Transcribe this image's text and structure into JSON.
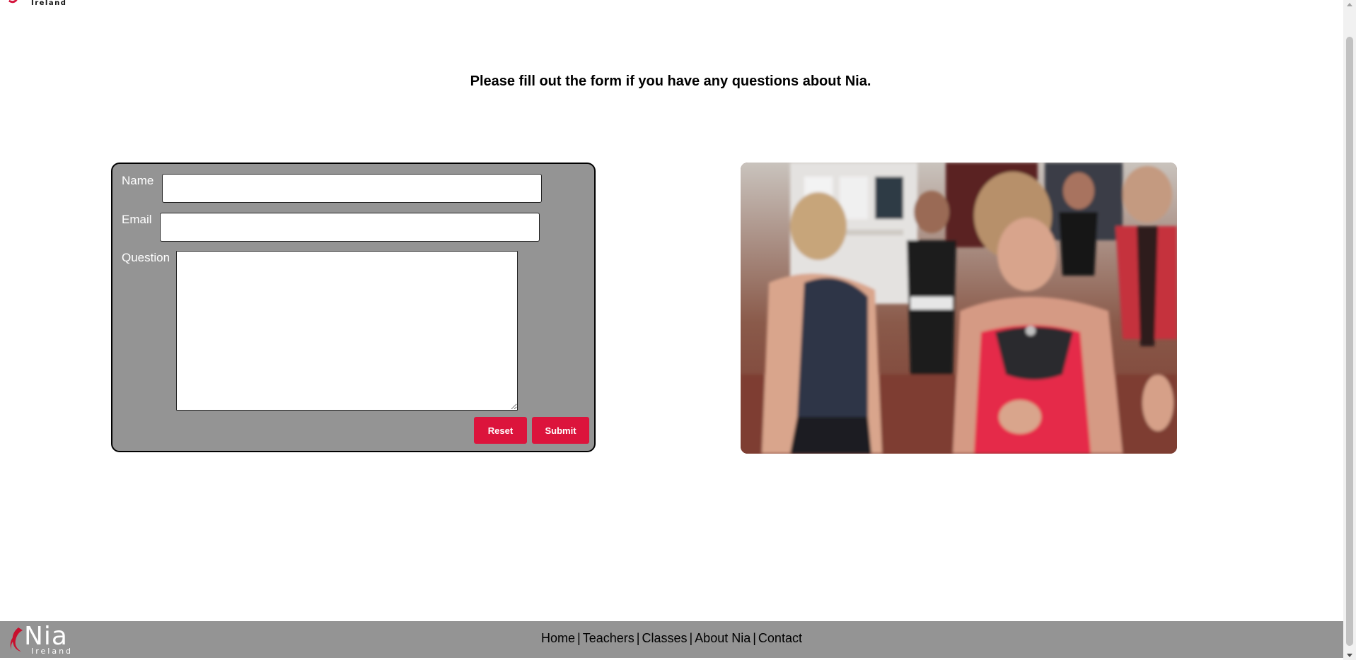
{
  "top_logo": {
    "text": "Ireland"
  },
  "heading": "Please fill out the form if you have any questions about Nia.",
  "form": {
    "name_label": "Name",
    "email_label": "Email",
    "question_label": "Question",
    "name_value": "",
    "email_value": "",
    "question_value": "",
    "reset_label": "Reset",
    "submit_label": "Submit"
  },
  "footer": {
    "logo_name": "Nia",
    "logo_sub": "Ireland",
    "nav": [
      {
        "label": "Home"
      },
      {
        "label": "Teachers"
      },
      {
        "label": "Classes"
      },
      {
        "label": "About Nia"
      },
      {
        "label": "Contact"
      }
    ],
    "separator": "|"
  },
  "colors": {
    "accent": "#dc143c",
    "panel": "#949494"
  },
  "icons": {
    "logo": "nia-flame-logo",
    "scroll_up": "scroll-up-arrow",
    "scroll_down": "scroll-down-arrow"
  }
}
